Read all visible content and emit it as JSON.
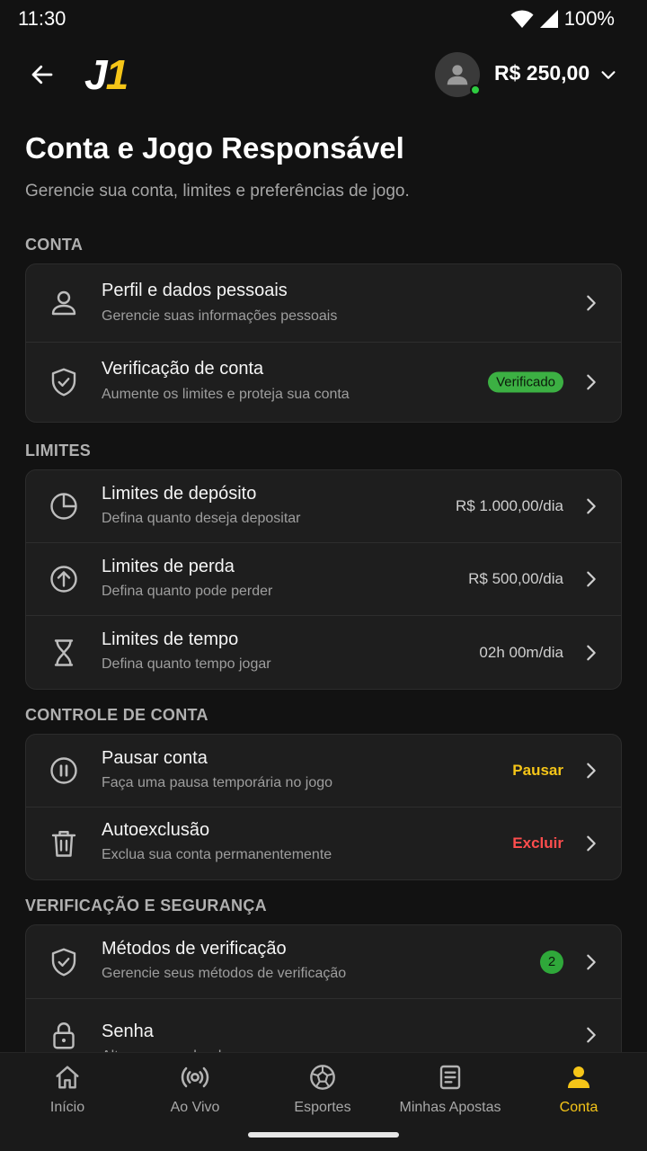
{
  "status_bar": {
    "time": "11:30",
    "battery": "100%"
  },
  "header": {
    "logo_j": "J",
    "logo_one": "1",
    "balance": "R$ 250,00"
  },
  "page": {
    "title": "Conta e Jogo Responsável",
    "subtitle": "Gerencie sua conta, limites e preferências de jogo."
  },
  "sections": {
    "conta": {
      "label": "CONTA",
      "items": [
        {
          "title": "Perfil e dados pessoais",
          "desc": "Gerencie suas informações pessoais"
        },
        {
          "title": "Verificação de conta",
          "desc": "Aumente os limites e proteja sua conta",
          "badge": "Verificado"
        }
      ]
    },
    "limites": {
      "label": "LIMITES",
      "items": [
        {
          "title": "Limites de depósito",
          "desc": "Defina quanto deseja depositar",
          "value": "R$ 1.000,00/dia"
        },
        {
          "title": "Limites de perda",
          "desc": "Defina quanto pode perder",
          "value": "R$ 500,00/dia"
        },
        {
          "title": "Limites de tempo",
          "desc": "Defina quanto tempo jogar",
          "value": "02h 00m/dia"
        }
      ]
    },
    "controle": {
      "label": "CONTROLE DE CONTA",
      "items": [
        {
          "title": "Pausar conta",
          "desc": "Faça uma pausa temporária no jogo",
          "action": "Pausar"
        },
        {
          "title": "Autoexclusão",
          "desc": "Exclua sua conta permanentemente",
          "action": "Excluir"
        }
      ]
    },
    "seguranca": {
      "label": "VERIFICAÇÃO E SEGURANÇA",
      "items": [
        {
          "title": "Métodos de verificação",
          "desc": "Gerencie seus métodos de verificação",
          "count": "2"
        },
        {
          "title": "Senha",
          "desc": "Altere sua senha de acesso"
        }
      ]
    }
  },
  "colors": {
    "accent": "#f5c518",
    "danger": "#ff4d4d",
    "success": "#3cb043",
    "background": "#121212",
    "card": "#1e1e1e"
  },
  "nav": {
    "items": [
      {
        "label": "Início",
        "icon": "home-icon"
      },
      {
        "label": "Ao Vivo",
        "icon": "live-broadcast-icon"
      },
      {
        "label": "Esportes",
        "icon": "soccer-ball-icon"
      },
      {
        "label": "Minhas Apostas",
        "icon": "bet-slip-icon"
      },
      {
        "label": "Conta",
        "icon": "user-icon",
        "active": true
      }
    ]
  }
}
